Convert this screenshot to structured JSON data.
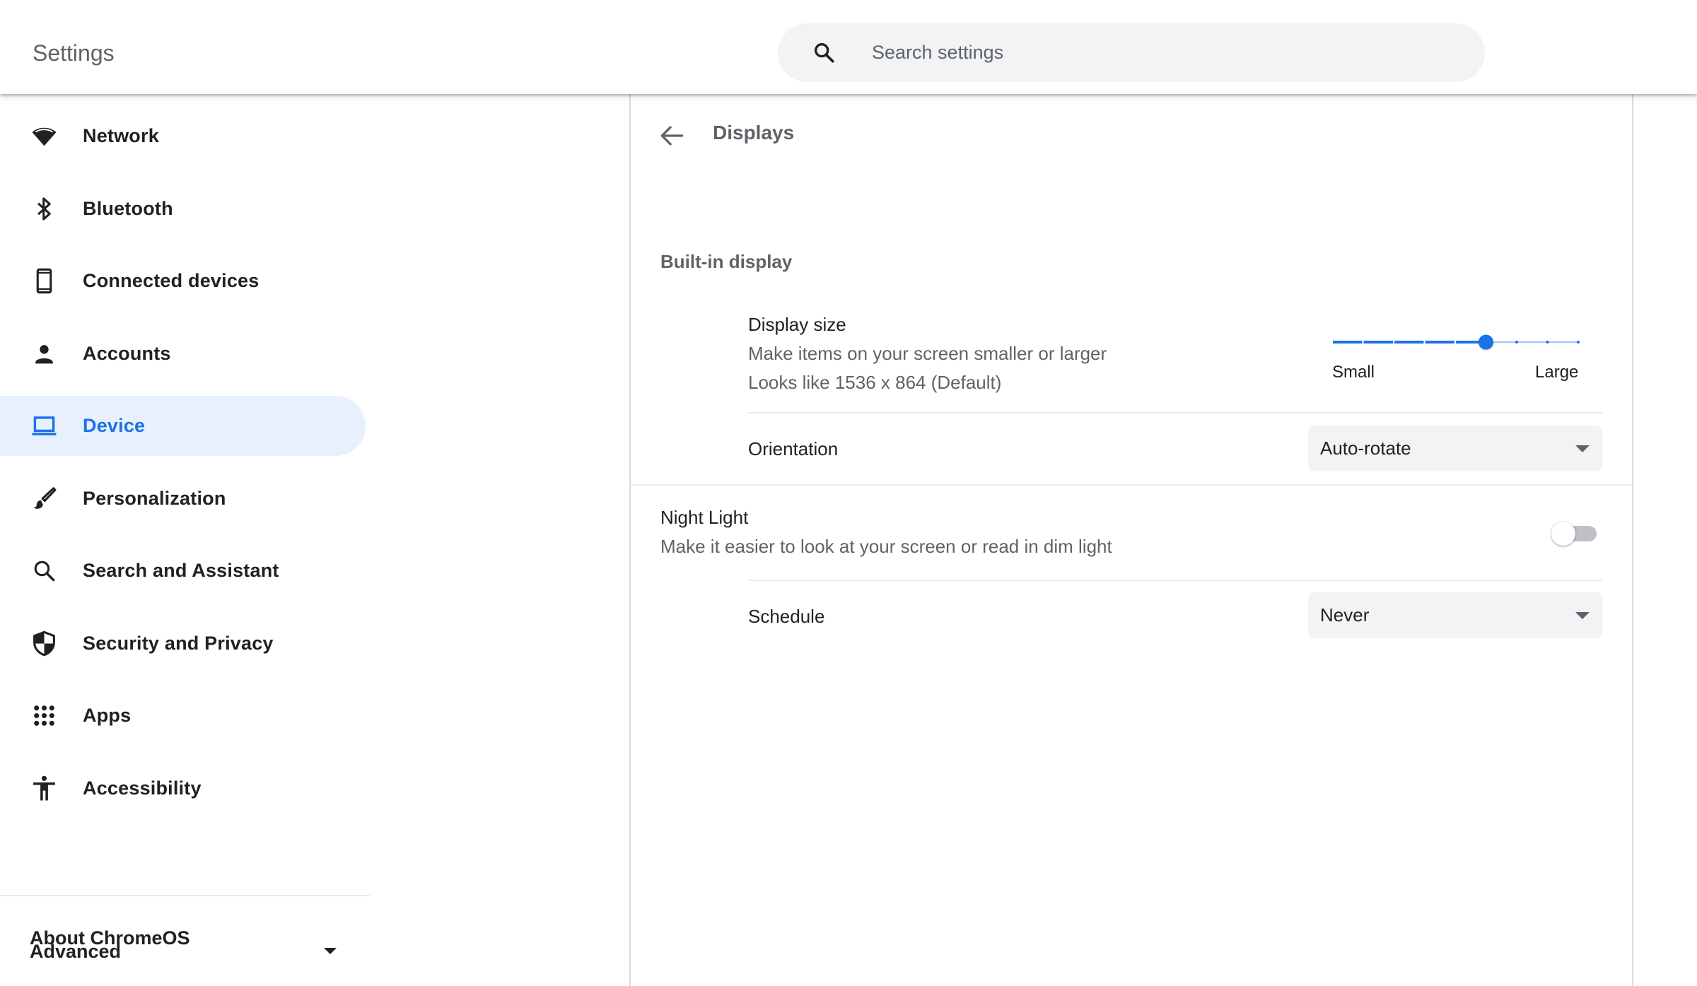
{
  "header": {
    "title": "Settings",
    "search": {
      "placeholder": "Search settings",
      "value": "",
      "icon": "search-icon"
    }
  },
  "sidebar": {
    "items": [
      {
        "label": "Network",
        "icon": "wifi-icon",
        "active": false
      },
      {
        "label": "Bluetooth",
        "icon": "bluetooth-icon",
        "active": false
      },
      {
        "label": "Connected devices",
        "icon": "phone-icon",
        "active": false
      },
      {
        "label": "Accounts",
        "icon": "person-icon",
        "active": false
      },
      {
        "label": "Device",
        "icon": "laptop-icon",
        "active": true
      },
      {
        "label": "Personalization",
        "icon": "paintbrush-icon",
        "active": false
      },
      {
        "label": "Search and Assistant",
        "icon": "search-icon",
        "active": false
      },
      {
        "label": "Security and Privacy",
        "icon": "shield-icon",
        "active": false
      },
      {
        "label": "Apps",
        "icon": "apps-grid-icon",
        "active": false
      },
      {
        "label": "Accessibility",
        "icon": "accessibility-icon",
        "active": false
      }
    ],
    "advanced": {
      "label": "Advanced",
      "icon": "caret-down-icon",
      "expanded": false
    },
    "about": {
      "label": "About ChromeOS"
    }
  },
  "main": {
    "back_icon": "arrow-back-icon",
    "page_title": "Displays",
    "built_in": {
      "section_title": "Built-in display",
      "display_size": {
        "label": "Display size",
        "description": "Make items on your screen smaller or larger",
        "resolution": "Looks like 1536 x 864 (Default)",
        "slider": {
          "min_label": "Small",
          "max_label": "Large",
          "steps": 9,
          "value_index": 5
        }
      },
      "orientation": {
        "label": "Orientation",
        "selected": "Auto-rotate"
      }
    },
    "night_light": {
      "label": "Night Light",
      "description": "Make it easier to look at your screen or read in dim light",
      "enabled": false,
      "schedule": {
        "label": "Schedule",
        "selected": "Never"
      }
    }
  },
  "colors": {
    "accent": "#1a73e8",
    "active_bg": "#e8f0fe",
    "secondary_text": "#5f6368",
    "field_bg": "#f1f3f4",
    "slider_inactive": "#a8c7fa"
  }
}
